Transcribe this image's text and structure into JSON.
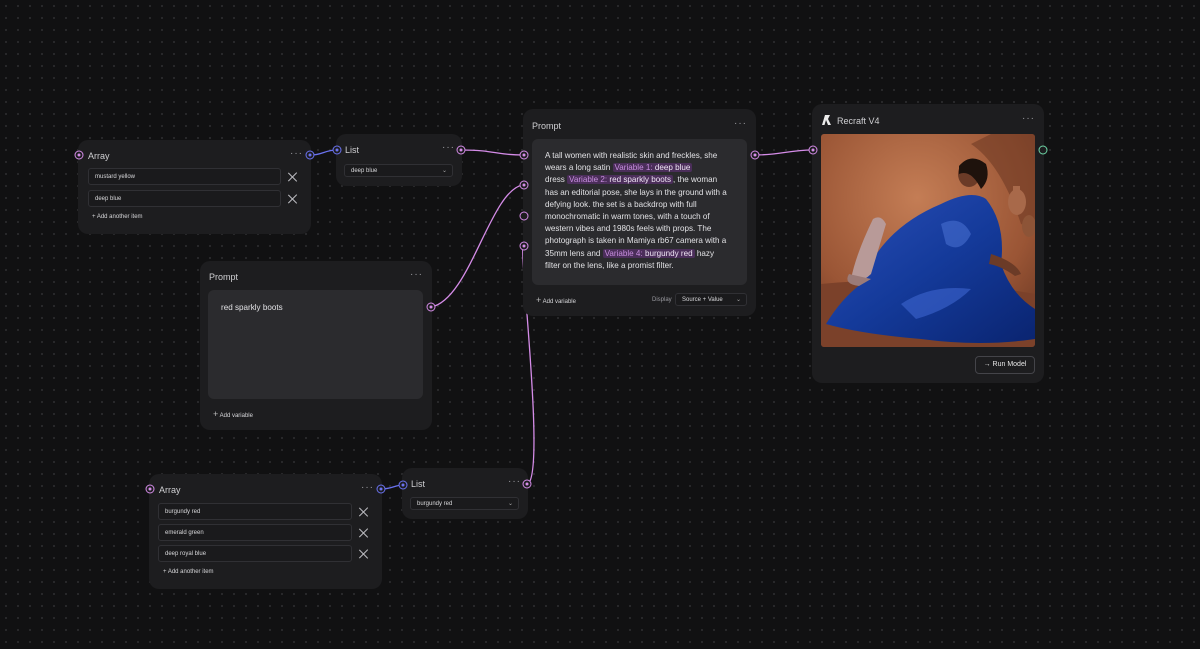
{
  "array_node_1": {
    "title": "Array",
    "menu_icon": "more-horizontal-icon",
    "items": [
      "mustard yellow",
      "deep blue"
    ],
    "add_label": "+ Add another item"
  },
  "list_node_1": {
    "title": "List",
    "menu_icon": "more-horizontal-icon",
    "selected": "deep blue"
  },
  "prompt_node_small": {
    "title": "Prompt",
    "menu_icon": "more-horizontal-icon",
    "text": "red sparkly boots",
    "add_variable_label": "Add variable"
  },
  "array_node_2": {
    "title": "Array",
    "menu_icon": "more-horizontal-icon",
    "items": [
      "burgundy red",
      "emerald green",
      "deep royal blue"
    ],
    "add_label": "+ Add another item"
  },
  "list_node_2": {
    "title": "List",
    "menu_icon": "more-horizontal-icon",
    "selected": "burgundy red"
  },
  "prompt_node_main": {
    "title": "Prompt",
    "menu_icon": "more-horizontal-icon",
    "text_lines": [
      "A tall women with realistic skin and freckles, she",
      "wears a long satin",
      "deep blue",
      "dress",
      "red sparkly boots",
      ", the woman",
      "has an editorial pose, she lays in the ground with a",
      "defying look. the set is a backdrop with full",
      "monochromatic in warm tones, with a touch of",
      "western vibes and 1980s feels with props. The",
      "photograph is taken in Mamiya rb67 camera with a",
      "35mm lens and",
      "burgundy red",
      "hazy",
      "filter on the lens, like a promist filter."
    ],
    "variables": [
      {
        "label": "Variable 1:",
        "value": "deep blue"
      },
      {
        "label": "Variable 2:",
        "value": "red sparkly boots"
      },
      {
        "label": "Variable 4:",
        "value": "burgundy red"
      }
    ],
    "add_variable_label": "Add variable",
    "display_label": "Display",
    "display_value": "Source + Value"
  },
  "model_node": {
    "title": "Recraft V4",
    "logo_icon": "recraft-logo-icon",
    "menu_icon": "more-horizontal-icon",
    "image_alt": "woman in blue satin dress and sparkly boots reclining on warm-toned backdrop",
    "run_label": "Run Model",
    "run_icon": "arrow-right-icon"
  },
  "colors": {
    "canvas": "#111112",
    "node": "#1d1d1f",
    "wire": "#d58ce8",
    "port_blue": "#6a72f0",
    "port_green": "#6fd7a7",
    "variable_chip": "#4b2e5a"
  }
}
